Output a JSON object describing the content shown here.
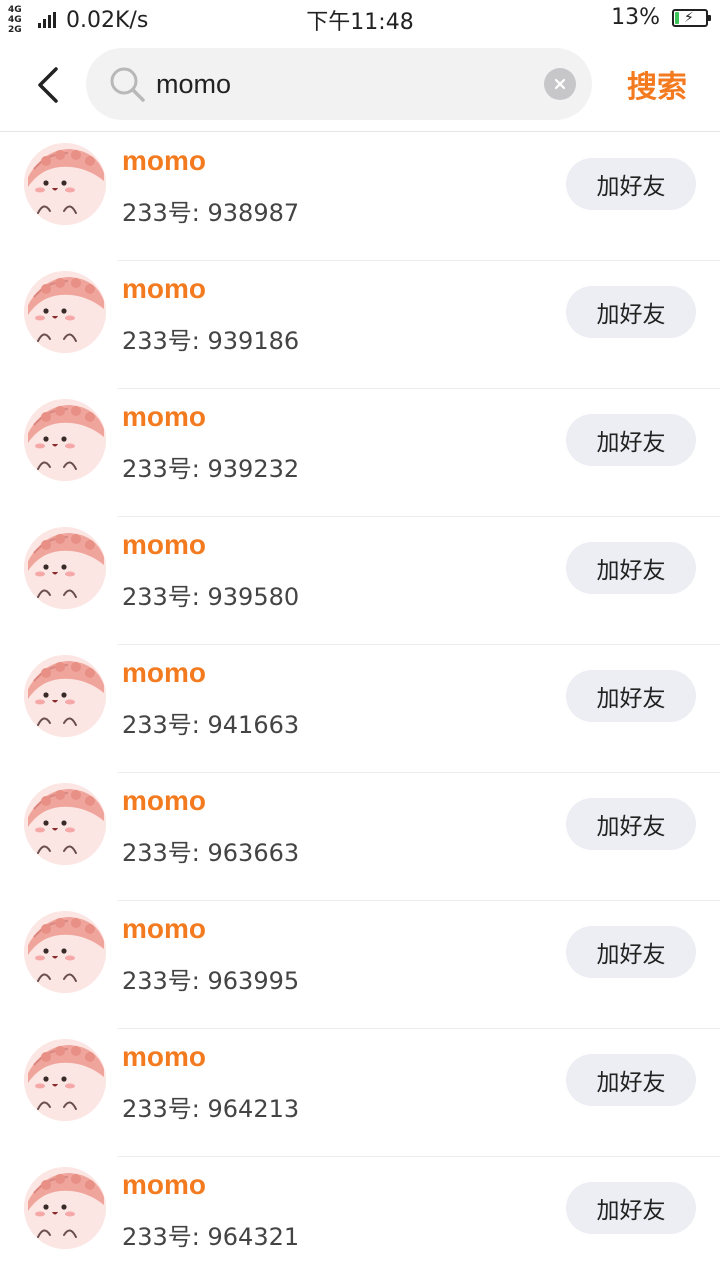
{
  "status_bar": {
    "network_tag": "4G 4G 2G",
    "speed": "0.02K/s",
    "time": "下午11:48",
    "battery_percent": "13%",
    "battery_level": 0.13,
    "battery_color": "#3cc35a"
  },
  "header": {
    "back_icon": "chevron-left-icon",
    "search_icon": "magnifier-icon",
    "search_query": "momo",
    "clear_icon": "clear-x-icon",
    "search_button": "搜索"
  },
  "colors": {
    "accent": "#f47a1f",
    "button_bg": "#eceef3"
  },
  "results": [
    {
      "name": "momo",
      "uid": "233号: 938987",
      "action": "加好友"
    },
    {
      "name": "momo",
      "uid": "233号: 939186",
      "action": "加好友"
    },
    {
      "name": "momo",
      "uid": "233号: 939232",
      "action": "加好友"
    },
    {
      "name": "momo",
      "uid": "233号: 939580",
      "action": "加好友"
    },
    {
      "name": "momo",
      "uid": "233号: 941663",
      "action": "加好友"
    },
    {
      "name": "momo",
      "uid": "233号: 963663",
      "action": "加好友"
    },
    {
      "name": "momo",
      "uid": "233号: 963995",
      "action": "加好友"
    },
    {
      "name": "momo",
      "uid": "233号: 964213",
      "action": "加好友"
    },
    {
      "name": "momo",
      "uid": "233号: 964321",
      "action": "加好友"
    }
  ]
}
